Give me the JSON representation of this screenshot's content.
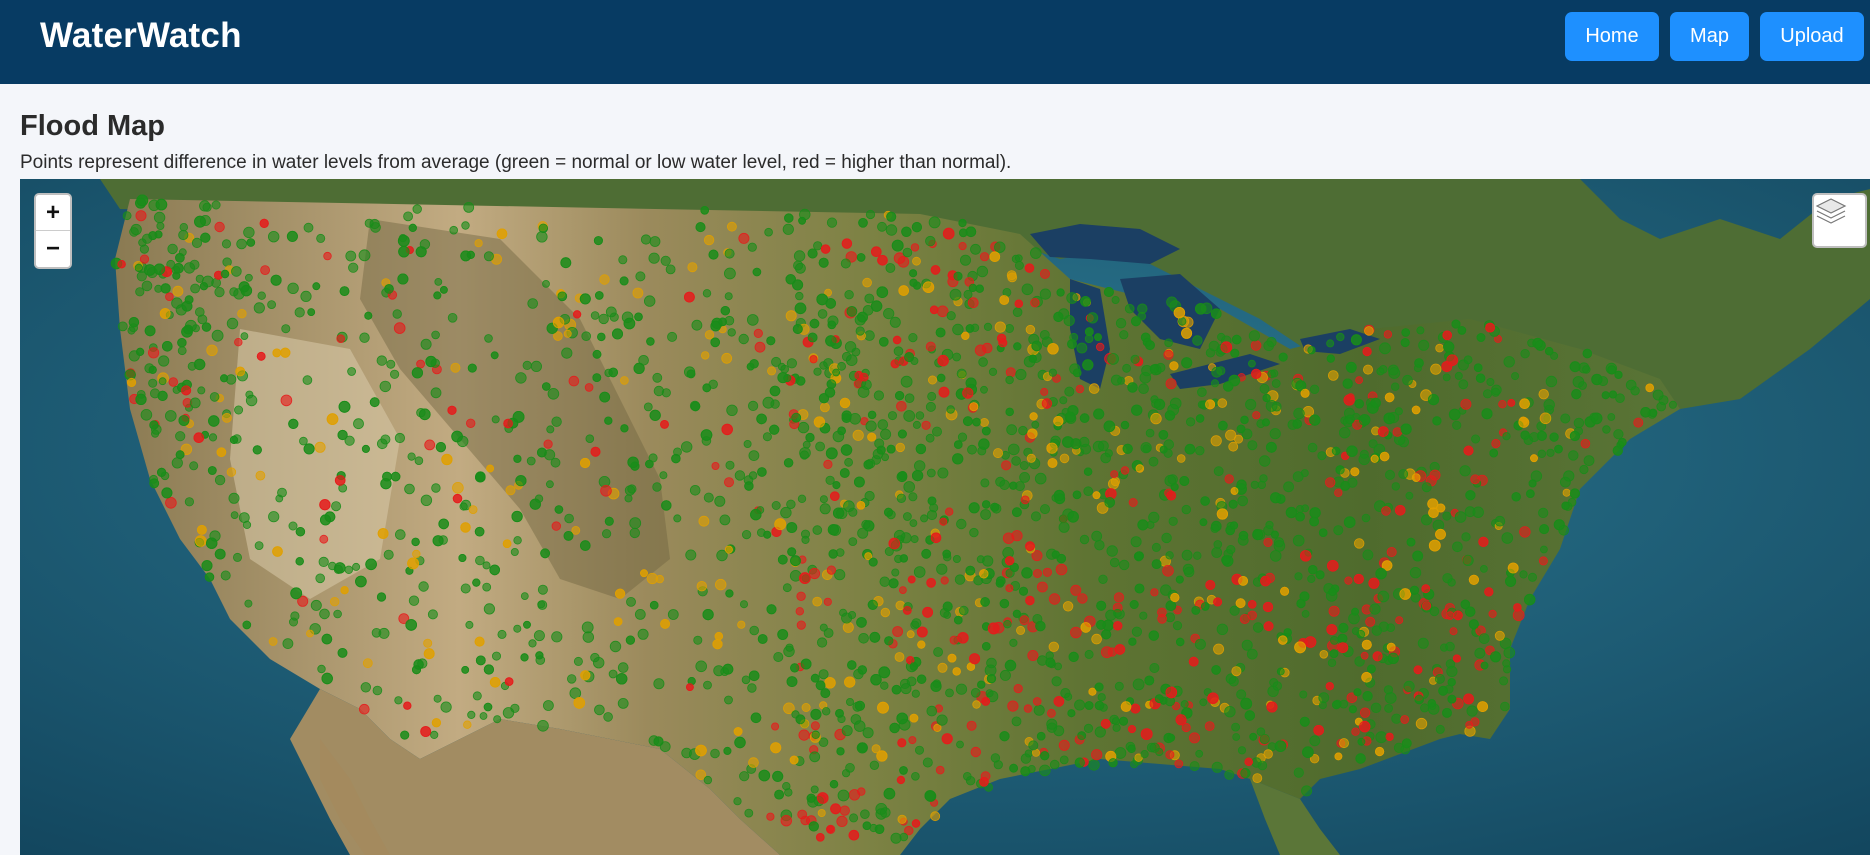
{
  "header": {
    "brand": "WaterWatch",
    "nav": [
      {
        "label": "Home"
      },
      {
        "label": "Map"
      },
      {
        "label": "Upload"
      }
    ]
  },
  "page": {
    "title": "Flood Map",
    "description": "Points represent difference in water levels from average (green = normal or low water level, red = higher than normal)."
  },
  "map": {
    "zoom_in_label": "+",
    "zoom_out_label": "−",
    "layers_icon": "layers-icon",
    "colors": {
      "normal": "#1a8c1a",
      "elevated": "#e0a000",
      "high": "#e51c1c",
      "ocean": "#1e5d78",
      "land": "#6f7a3a",
      "arid": "#b8a078"
    }
  }
}
